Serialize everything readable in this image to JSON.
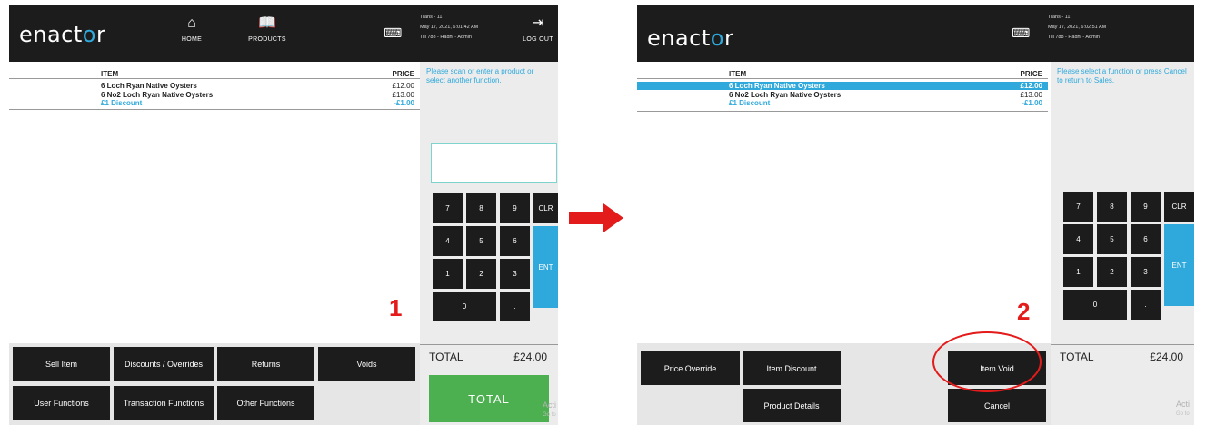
{
  "screen1": {
    "logo": {
      "pre": "enact",
      "o": "o",
      "post": "r"
    },
    "nav": [
      {
        "icon": "home-icon",
        "glyph": "⌂",
        "label": "HOME"
      },
      {
        "icon": "book-icon",
        "glyph": "📖",
        "label": "PRODUCTS"
      }
    ],
    "keyboard_glyph": "⌨",
    "info": [
      "Trans - 11",
      "May 17, 2021, 6:01:42 AM",
      "Till 788 - Hadhi - Admin"
    ],
    "logout": {
      "glyph": "⇥",
      "label": "LOG OUT"
    },
    "headers": {
      "item": "ITEM",
      "price": "PRICE"
    },
    "rows": [
      {
        "item": "6 Loch Ryan Native Oysters",
        "price": "£12.00"
      },
      {
        "item": "6 No2 Loch Ryan Native Oysters",
        "price": "£13.00"
      },
      {
        "item": "£1 Discount",
        "price": "-£1.00"
      }
    ],
    "message": "Please scan or enter a product or select another function.",
    "keypad": [
      "7",
      "8",
      "9",
      "CLR",
      "4",
      "5",
      "6",
      "1",
      "2",
      "3",
      "0",
      ".",
      "ENT"
    ],
    "total_label": "TOTAL",
    "total_value": "£24.00",
    "total_button": "TOTAL",
    "functions": [
      "Sell Item",
      "Discounts / Overrides",
      "Returns",
      "Voids",
      "User Functions",
      "Transaction Functions",
      "Other Functions"
    ],
    "step": "1",
    "watermark": "Acti",
    "watermark2": "Go to"
  },
  "screen2": {
    "logo": {
      "pre": "enact",
      "o": "o",
      "post": "r"
    },
    "keyboard_glyph": "⌨",
    "info": [
      "Trans - 11",
      "May 17, 2021, 6:02:51 AM",
      "Till 788 - Hadhi - Admin"
    ],
    "headers": {
      "item": "ITEM",
      "price": "PRICE"
    },
    "rows": [
      {
        "item": "6 Loch Ryan Native Oysters",
        "price": "£12.00"
      },
      {
        "item": "6 No2 Loch Ryan Native Oysters",
        "price": "£13.00"
      },
      {
        "item": "£1 Discount",
        "price": "-£1.00"
      }
    ],
    "message": "Please select a function or press Cancel to return to Sales.",
    "keypad": [
      "7",
      "8",
      "9",
      "CLR",
      "4",
      "5",
      "6",
      "1",
      "2",
      "3",
      "0",
      ".",
      "ENT"
    ],
    "total_label": "TOTAL",
    "total_value": "£24.00",
    "functions": [
      "Price Override",
      "Item Discount",
      "Item Void",
      "Product Details",
      "Cancel"
    ],
    "step": "2",
    "watermark": "Acti",
    "watermark2": "Go to"
  },
  "colors": {
    "accent": "#2fa9dc",
    "total_green": "#4caf50",
    "annotation_red": "#e31b1b",
    "topbar": "#1c1c1c"
  }
}
